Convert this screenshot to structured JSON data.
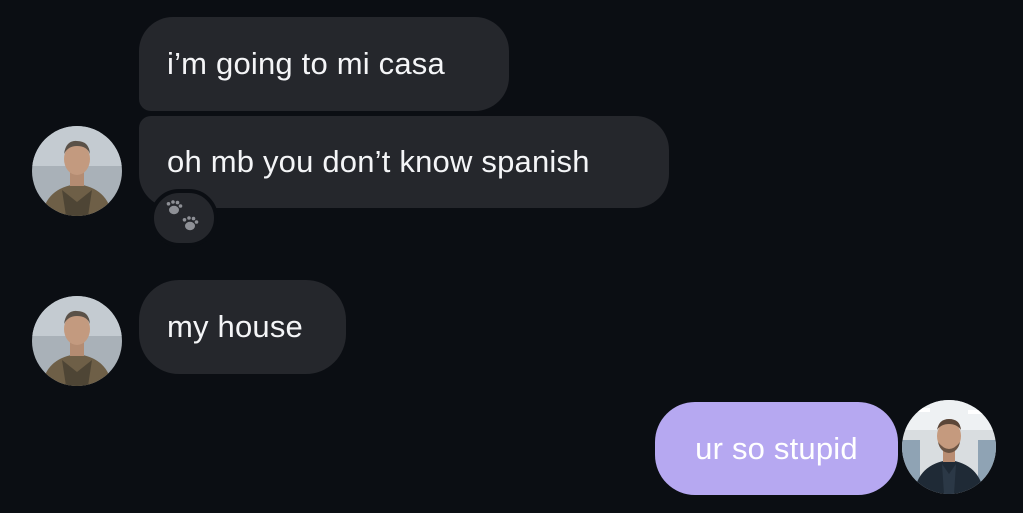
{
  "messages": [
    {
      "sender": "other",
      "text": "i’m going to mi casa"
    },
    {
      "sender": "other",
      "text": "oh mb you don’t know spanish",
      "reaction": "paw-prints-icon"
    },
    {
      "sender": "other",
      "text": "my house"
    },
    {
      "sender": "self",
      "text": "ur so stupid"
    }
  ],
  "colors": {
    "background": "#0b0e13",
    "incoming_bubble": "#25272c",
    "outgoing_bubble": "#b6a8f1",
    "text": "#f4f5f7"
  }
}
